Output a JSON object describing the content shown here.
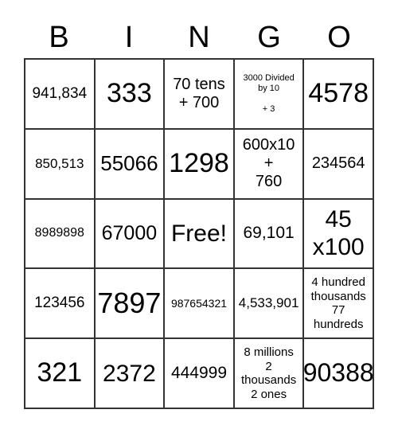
{
  "header": [
    "B",
    "I",
    "N",
    "G",
    "O"
  ],
  "cells": [
    [
      "941,834",
      "333",
      "70 tens\n+ 700",
      "3000 Divided\nby 10\n\n+ 3",
      "4578"
    ],
    [
      "850,513",
      "55066",
      "1298",
      "600x10\n+\n760",
      "234564"
    ],
    [
      "8989898",
      "67000",
      "Free!",
      "69,101",
      "45\nx100"
    ],
    [
      "123456",
      "7897",
      "987654321",
      "4,533,901",
      "4 hundred\nthousands\n77\nhundreds"
    ],
    [
      "321",
      "2372",
      "444999",
      "8 millions\n2\nthousands\n2 ones",
      "90388"
    ]
  ]
}
